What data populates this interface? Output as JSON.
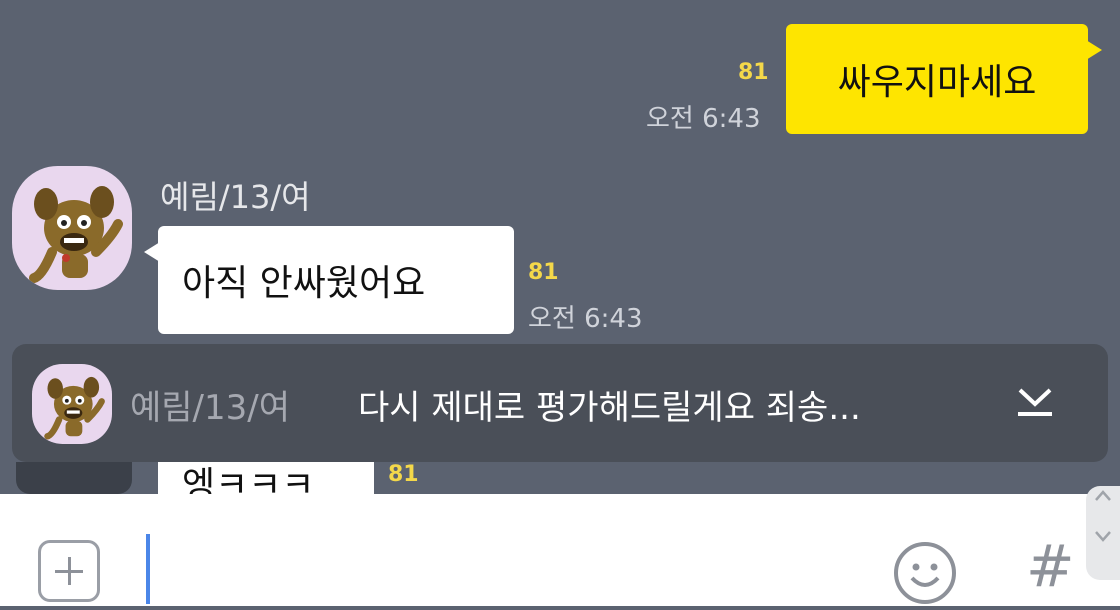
{
  "outgoing": {
    "text": "싸우지마세요",
    "unread": "81",
    "time": "오전 6:43"
  },
  "incoming": {
    "sender": "예림/13/여",
    "text": "아직 안싸웠어요",
    "unread": "81",
    "time": "오전 6:43"
  },
  "banner": {
    "sender": "예림/13/여",
    "preview": "다시 제대로 평가해드릴게요 죄송...",
    "collapse_icon": "chevron-down-bar-icon"
  },
  "partial_message": {
    "text": "엥ㅋㅋㅋ",
    "unread": "81"
  },
  "input": {
    "value": "",
    "add_icon": "plus-square-icon",
    "emoji_icon": "smiley-icon",
    "hash_label": "#"
  },
  "colors": {
    "background": "#5b6270",
    "outgoing_bubble": "#fee500",
    "unread_count": "#f4d84a",
    "banner": "#4a4f58"
  }
}
